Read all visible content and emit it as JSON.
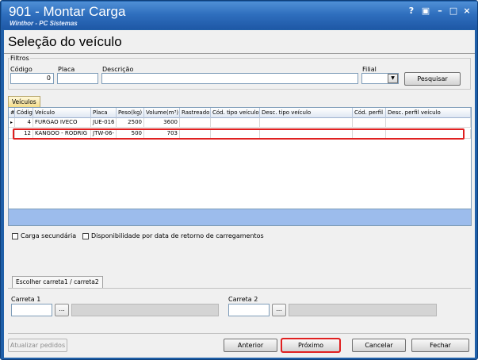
{
  "window": {
    "title": "901 - Montar Carga",
    "subtitle": "Winthor - PC Sistemas",
    "controls": [
      "?",
      "▣",
      "–",
      "□",
      "×"
    ]
  },
  "page": {
    "heading": "Seleção do veículo"
  },
  "filters": {
    "legend": "Filtros",
    "codigo_label": "Código",
    "codigo_value": "0",
    "placa_label": "Placa",
    "placa_value": "",
    "descricao_label": "Descrição",
    "descricao_value": "",
    "filial_label": "Filial",
    "filial_value": "",
    "search_button": "Pesquisar"
  },
  "vehicles": {
    "tab_label": "Veículos",
    "columns": [
      "#",
      "Códig",
      "Veículo",
      "Placa",
      "Peso(kg)",
      "Volume(m³)",
      "Rastreado",
      "Cód. tipo veículo",
      "Desc. tipo veículo",
      "Cód. perfil",
      "Desc. perfil veículo"
    ],
    "rows": [
      {
        "marker": "▸",
        "codigo": "4",
        "veiculo": "FURGAO IVECO",
        "placa": "JUE-016",
        "peso": "2500",
        "volume": "3600",
        "rastreado": "",
        "cod_tipo": "",
        "desc_tipo": "",
        "cod_perfil": "",
        "desc_perfil": ""
      },
      {
        "marker": "",
        "codigo": "12",
        "veiculo": "KANGOO - RODRIG",
        "placa": "JTW-06-",
        "peso": "500",
        "volume": "703",
        "rastreado": "",
        "cod_tipo": "",
        "desc_tipo": "",
        "cod_perfil": "",
        "desc_perfil": ""
      }
    ]
  },
  "options": {
    "carga_secundaria": "Carga secundária",
    "carga_secundaria_checked": false,
    "disponibilidade": "Disponibilidade por data de retorno de carregamentos",
    "disponibilidade_checked": false
  },
  "carretas": {
    "tab_label": "Escolher carreta1 / carreta2",
    "carreta1_label": "Carreta 1",
    "carreta1_code": "",
    "carreta1_desc": "",
    "carreta2_label": "Carreta 2",
    "carreta2_code": "",
    "carreta2_desc": "",
    "browse": "..."
  },
  "footer": {
    "atualizar": "Atualizar pedidos",
    "anterior": "Anterior",
    "proximo": "Próximo",
    "cancelar": "Cancelar",
    "fechar": "Fechar"
  },
  "colors": {
    "titlebar": "#2f6fbe",
    "highlight": "#e02020",
    "grid_foot": "#9cbcec",
    "tab_active": "#f4dd8a"
  }
}
